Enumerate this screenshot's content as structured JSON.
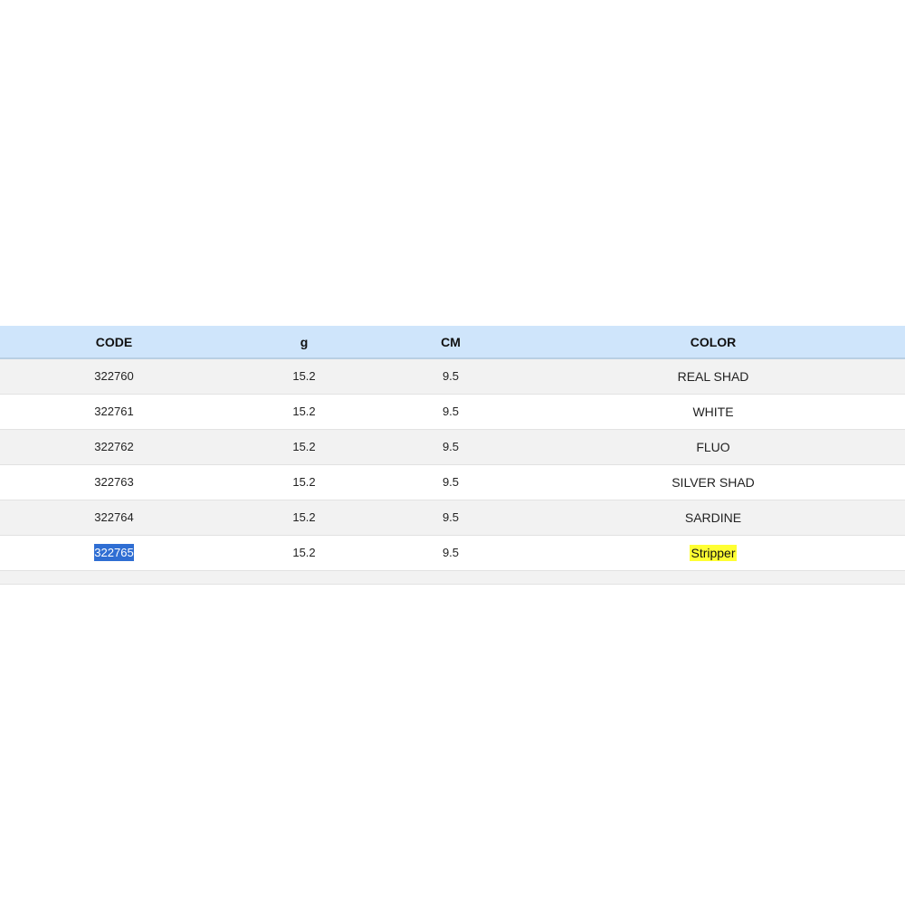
{
  "table": {
    "headers": {
      "code": "CODE",
      "g": "g",
      "cm": "CM",
      "color": "COLOR"
    },
    "rows": [
      {
        "code": "322760",
        "g": "15.2",
        "cm": "9.5",
        "color": "REAL SHAD"
      },
      {
        "code": "322761",
        "g": "15.2",
        "cm": "9.5",
        "color": "WHITE"
      },
      {
        "code": "322762",
        "g": "15.2",
        "cm": "9.5",
        "color": "FLUO"
      },
      {
        "code": "322763",
        "g": "15.2",
        "cm": "9.5",
        "color": "SILVER SHAD"
      },
      {
        "code": "322764",
        "g": "15.2",
        "cm": "9.5",
        "color": "SARDINE"
      },
      {
        "code": "322765",
        "g": "15.2",
        "cm": "9.5",
        "color": "Stripper"
      }
    ]
  },
  "colors": {
    "header_background": "#cfe5fb",
    "selection_highlight": "#2f6ed3",
    "text_highlight": "#ffff33"
  }
}
